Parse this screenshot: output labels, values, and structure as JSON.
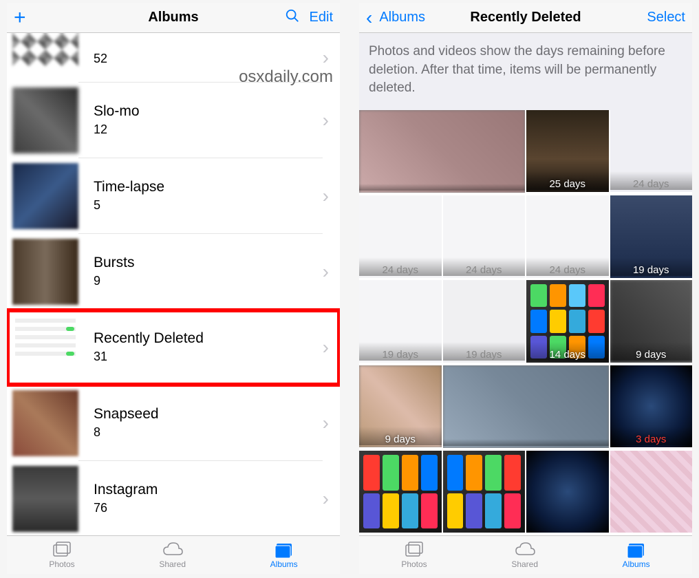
{
  "watermark": "osxdaily.com",
  "left": {
    "nav": {
      "title": "Albums",
      "edit": "Edit"
    },
    "albums": [
      {
        "name": "",
        "count": "52"
      },
      {
        "name": "Slo-mo",
        "count": "12"
      },
      {
        "name": "Time-lapse",
        "count": "5"
      },
      {
        "name": "Bursts",
        "count": "9"
      },
      {
        "name": "Recently Deleted",
        "count": "31"
      },
      {
        "name": "Snapseed",
        "count": "8"
      },
      {
        "name": "Instagram",
        "count": "76"
      }
    ],
    "tabs": {
      "photos": "Photos",
      "shared": "Shared",
      "albums": "Albums"
    }
  },
  "right": {
    "nav": {
      "back": "Albums",
      "title": "Recently Deleted",
      "select": "Select"
    },
    "info": "Photos and videos show the days remaining before deletion. After that time, items will be permanently deleted.",
    "thumbs": [
      {
        "days": ""
      },
      {
        "days": ""
      },
      {
        "days": "25 days"
      },
      {
        "days": "24 days"
      },
      {
        "days": "24 days"
      },
      {
        "days": "24 days"
      },
      {
        "days": "24 days"
      },
      {
        "days": "19 days"
      },
      {
        "days": "19 days"
      },
      {
        "days": "19 days"
      },
      {
        "days": "14 days"
      },
      {
        "days": "9 days"
      },
      {
        "days": "9 days"
      },
      {
        "days": ""
      },
      {
        "days": ""
      },
      {
        "days": "3 days",
        "red": true
      },
      {
        "days": ""
      },
      {
        "days": ""
      },
      {
        "days": ""
      },
      {
        "days": ""
      }
    ],
    "tabs": {
      "photos": "Photos",
      "shared": "Shared",
      "albums": "Albums"
    }
  }
}
